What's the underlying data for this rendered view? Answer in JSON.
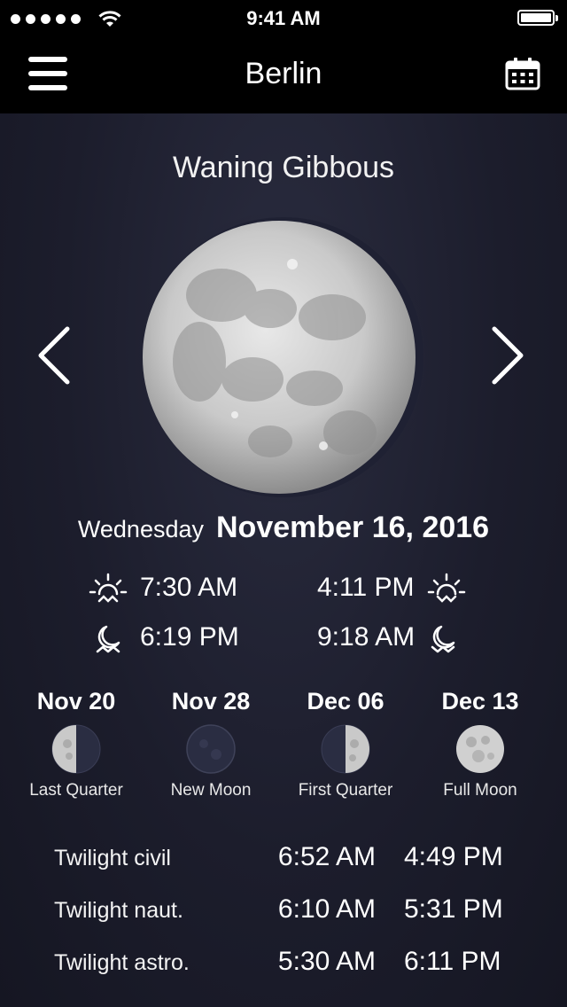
{
  "status": {
    "time": "9:41 AM",
    "signal_icon": "signal-dots-icon",
    "wifi_icon": "wifi-icon",
    "battery_icon": "battery-icon",
    "battery_level": 1.0
  },
  "nav": {
    "title": "Berlin",
    "menu_icon": "hamburger-menu-icon",
    "calendar_icon": "calendar-icon"
  },
  "moon": {
    "phase_name": "Waning Gibbous",
    "prev_icon": "chevron-left-icon",
    "next_icon": "chevron-right-icon"
  },
  "date": {
    "weekday": "Wednesday",
    "full": "November 16, 2016"
  },
  "times": {
    "sunrise": "7:30 AM",
    "sunset": "4:11 PM",
    "moonrise": "6:19 PM",
    "moonset": "9:18 AM"
  },
  "upcoming": [
    {
      "date": "Nov 20",
      "label": "Last Quarter",
      "icon": "last-quarter-moon-icon"
    },
    {
      "date": "Nov 28",
      "label": "New Moon",
      "icon": "new-moon-icon"
    },
    {
      "date": "Dec 06",
      "label": "First Quarter",
      "icon": "first-quarter-moon-icon"
    },
    {
      "date": "Dec 13",
      "label": "Full Moon",
      "icon": "full-moon-icon"
    }
  ],
  "twilight": [
    {
      "label": "Twilight civil",
      "morning": "6:52 AM",
      "evening": "4:49 PM"
    },
    {
      "label": "Twilight naut.",
      "morning": "6:10 AM",
      "evening": "5:31 PM"
    },
    {
      "label": "Twilight astro.",
      "morning": "5:30 AM",
      "evening": "6:11 PM"
    }
  ],
  "colors": {
    "background": "#1a1b29",
    "bar": "#000000",
    "text": "#ffffff"
  }
}
